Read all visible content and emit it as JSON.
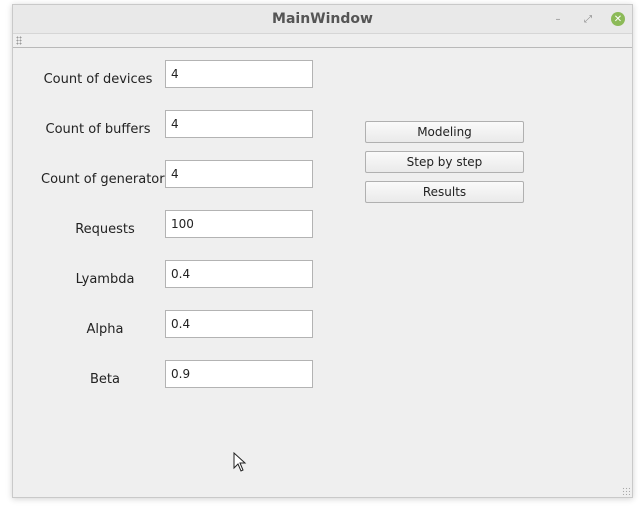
{
  "window": {
    "title": "MainWindow",
    "controls": {
      "minimize_icon": "minimize-icon",
      "maximize_icon": "maximize-icon",
      "close_icon": "close-icon",
      "minimize_glyph": "–",
      "maximize_glyph": "⤢",
      "close_glyph": "✕"
    }
  },
  "form": {
    "fields": [
      {
        "label": "Count of devices",
        "value": "4"
      },
      {
        "label": "Count of buffers",
        "value": "4"
      },
      {
        "label": "Count of generators",
        "value": "4"
      },
      {
        "label": "Requests",
        "value": "100"
      },
      {
        "label": "Lyambda",
        "value": "0.4"
      },
      {
        "label": "Alpha",
        "value": "0.4"
      },
      {
        "label": "Beta",
        "value": "0.9"
      }
    ]
  },
  "actions": {
    "modeling_label": "Modeling",
    "step_label": "Step by step",
    "results_label": "Results"
  },
  "colors": {
    "window_bg": "#efefef",
    "close_button": "#8cba58"
  }
}
